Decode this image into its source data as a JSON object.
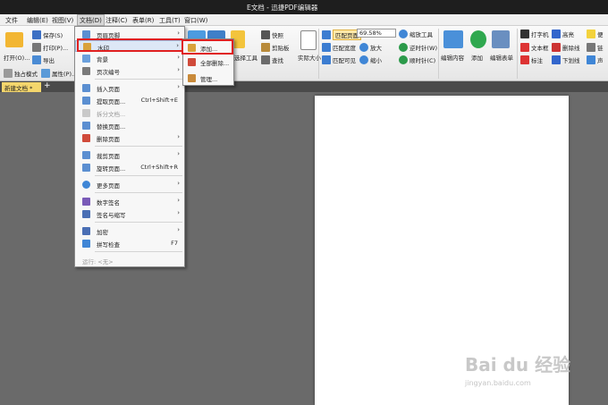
{
  "window": {
    "title": "E文档 - 迅捷PDF编辑器"
  },
  "menubar": [
    "文件",
    "编辑(E)",
    "视图(V)",
    "文档(D)",
    "注释(C)",
    "表单(R)",
    "工具(T)",
    "窗口(W)"
  ],
  "ribbon": {
    "open": "打开(O)...",
    "save": "保存(S)",
    "print": "打印(P)...",
    "export": "导出",
    "single_mode": "独占模式",
    "properties": "属性(P)...",
    "snapshot": "快照",
    "clipboard": "剪贴板",
    "find": "查找",
    "actual_size": "实际大小",
    "select_tool": "选择工具",
    "fit_page": "匹配页面",
    "fit_width": "匹配宽度",
    "fit_visible": "匹配可见",
    "zoom_value": "69.58%",
    "zoom_tool": "缩放工具",
    "zoom_in": "放大",
    "zoom_out": "缩小",
    "rotate_cw": "逆时针(W)",
    "rotate_ccw": "顺时针(C)",
    "edit_content": "编辑内容",
    "add": "添加",
    "edit_form": "编辑表单",
    "typewriter": "打字机",
    "textbox": "文本框",
    "callout": "标注",
    "highlight": "高亮",
    "strikeout": "删除线",
    "underline": "下划线",
    "note": "便",
    "link": "链",
    "sound": "声"
  },
  "tab": {
    "label": "新建文档 *",
    "plus": "+"
  },
  "document_menu": {
    "items": [
      {
        "label": "页眉页脚",
        "shortcut": "",
        "submenu": true,
        "disabled": false
      },
      {
        "label": "水印",
        "shortcut": "",
        "submenu": true,
        "disabled": false
      },
      {
        "label": "背景",
        "shortcut": "",
        "submenu": true,
        "disabled": false
      },
      {
        "label": "页次编号",
        "shortcut": "",
        "submenu": true,
        "disabled": false
      },
      {
        "label": "插入页面",
        "shortcut": "",
        "submenu": true,
        "disabled": false
      },
      {
        "label": "提取页面...",
        "shortcut": "Ctrl+Shift+E",
        "submenu": false,
        "disabled": false
      },
      {
        "label": "拆分文档...",
        "shortcut": "",
        "submenu": false,
        "disabled": true
      },
      {
        "label": "替换页面...",
        "shortcut": "",
        "submenu": false,
        "disabled": false
      },
      {
        "label": "删除页面",
        "shortcut": "",
        "submenu": true,
        "disabled": false
      },
      {
        "label": "裁剪页面",
        "shortcut": "",
        "submenu": true,
        "disabled": false
      },
      {
        "label": "旋转页面...",
        "shortcut": "Ctrl+Shift+R",
        "submenu": false,
        "disabled": false
      },
      {
        "label": "更多页面",
        "shortcut": "",
        "submenu": true,
        "disabled": false
      },
      {
        "label": "数字签名",
        "shortcut": "",
        "submenu": true,
        "disabled": false
      },
      {
        "label": "签名与缩写",
        "shortcut": "",
        "submenu": true,
        "disabled": false
      },
      {
        "label": "加密",
        "shortcut": "",
        "submenu": true,
        "disabled": false
      },
      {
        "label": "拼写检查",
        "shortcut": "F7",
        "submenu": false,
        "disabled": false
      },
      {
        "label": "运行: <无>",
        "shortcut": "",
        "submenu": false,
        "disabled": true
      }
    ]
  },
  "watermark_submenu": {
    "items": [
      "添加...",
      "全部删除...",
      "管理..."
    ]
  },
  "site_watermark": {
    "brand": "Bai du 经验",
    "url": "jingyan.baidu.com"
  }
}
